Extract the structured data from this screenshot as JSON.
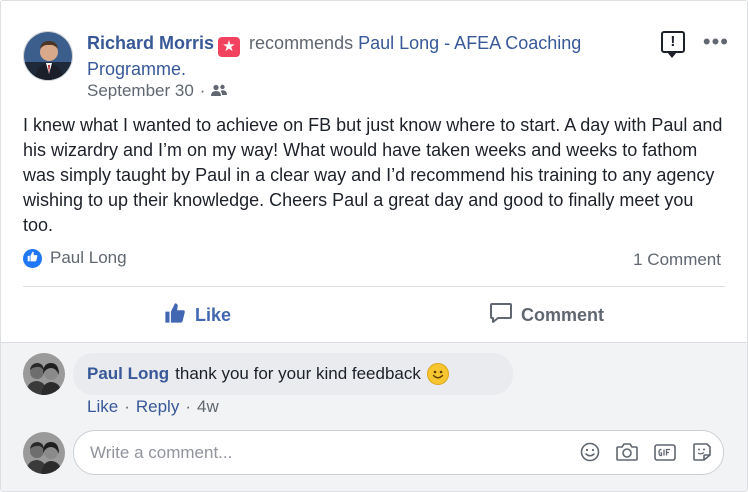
{
  "post": {
    "author": "Richard Morris",
    "recommends_text": "recommends",
    "recommended_page": "Paul Long - AFEA Coaching Programme.",
    "date": "September 30",
    "date_separator": "·",
    "audience_icon": "friends-icon",
    "body": "I knew what I wanted to achieve on FB but just know where to start. A day with Paul and his wizardry and I’m on my way! What would have taken weeks and weeks to fathom was simply taught by Paul in a clear way and I’d recommend his training to any agency wishing to up their knowledge. Cheers Paul a great day and good to finally meet you too."
  },
  "reactions": {
    "reactor": "Paul Long",
    "comment_count": "1 Comment"
  },
  "actions": {
    "like_label": "Like",
    "comment_label": "Comment"
  },
  "comments": [
    {
      "author": "Paul Long",
      "text": "thank you for your kind feedback",
      "like_label": "Like",
      "reply_label": "Reply",
      "time": "4w",
      "separator": "·"
    }
  ],
  "composer": {
    "placeholder": "Write a comment..."
  },
  "colors": {
    "link": "#385898",
    "like_blue": "#4267b2",
    "recommend_star": "#f3425f"
  }
}
